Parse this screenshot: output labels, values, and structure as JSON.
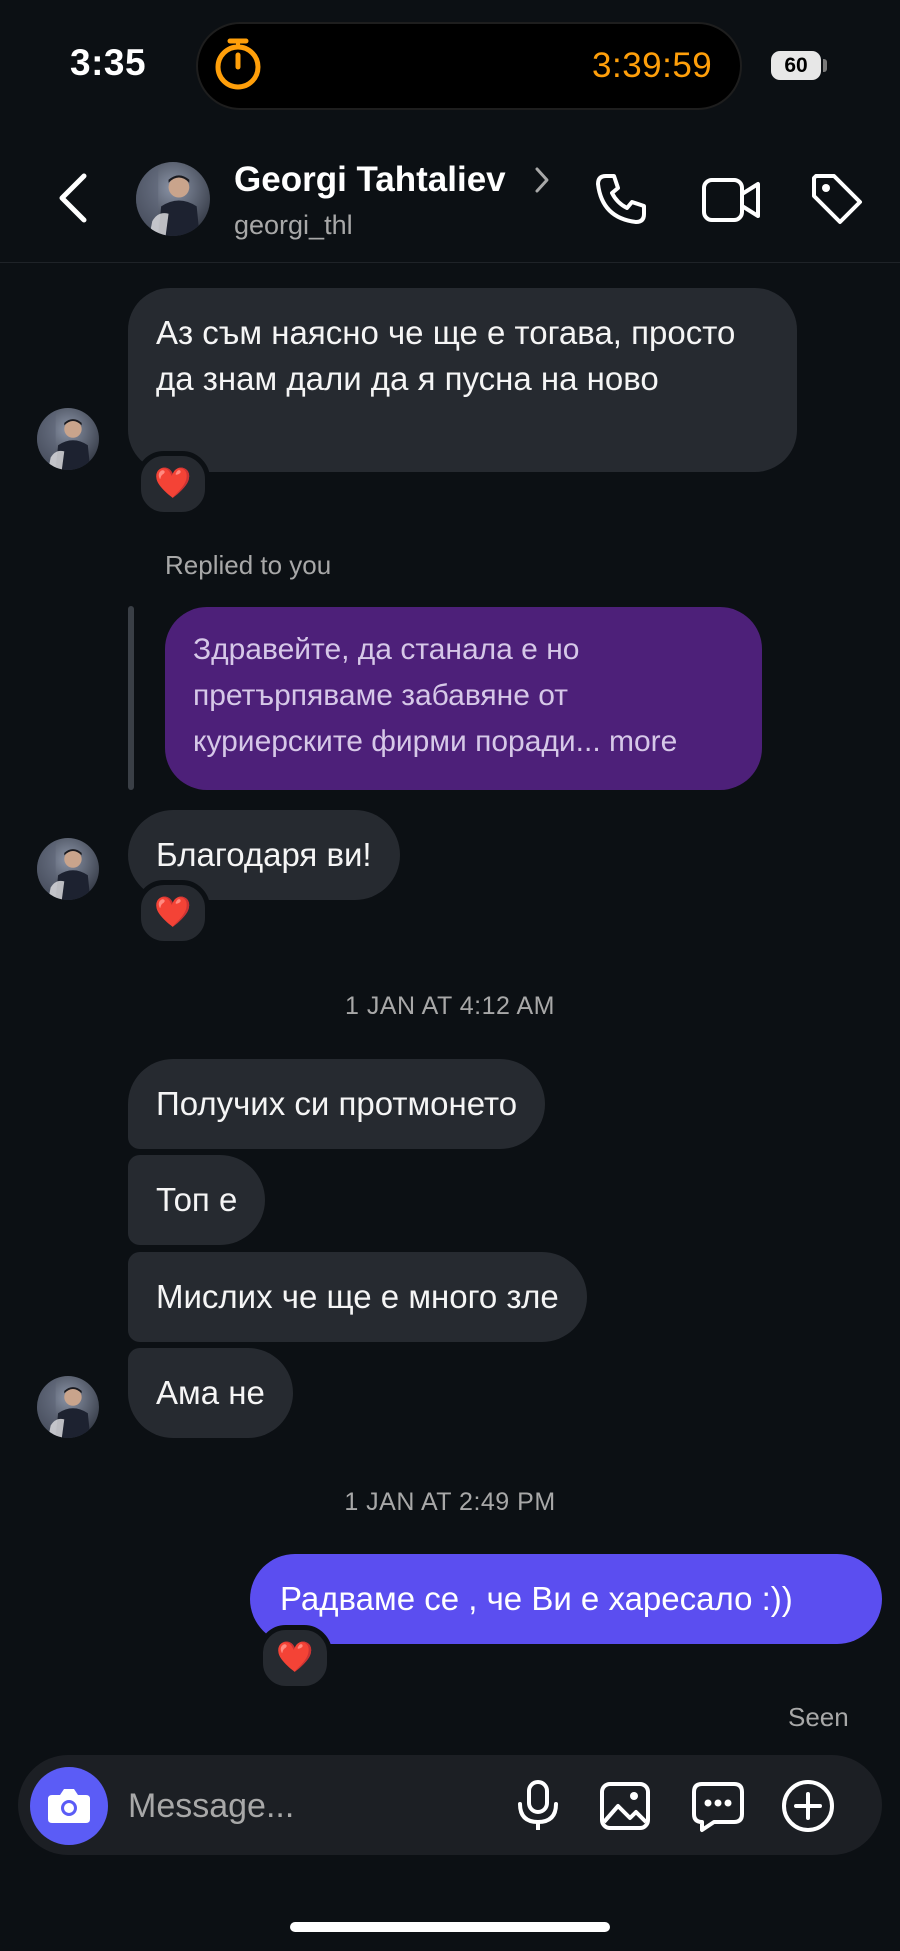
{
  "status_bar": {
    "time": "3:35",
    "timer": "3:39:59",
    "battery": "60"
  },
  "header": {
    "name": "Georgi Tahtaliev",
    "username": "georgi_thl"
  },
  "messages": {
    "m1": "Аз съм наясно че ще е тогава, просто да знам дали да я пусна на ново",
    "m1_reaction": "❤️",
    "replied_label": "Replied to you",
    "reply_quote": "Здравейте, да станала е но претърпяваме забавяне от куриерските фирми поради... more",
    "m2": "Благодаря ви!",
    "m2_reaction": "❤️",
    "date1": "1 JAN AT 4:12 AM",
    "m3": "Получих си протмонето",
    "m4": "Топ е",
    "m5": "Мислих че ще е много зле",
    "m6": "Ама не",
    "date2": "1 JAN AT 2:49 PM",
    "m7": "Радваме се , че Ви е харесало :))",
    "m7_reaction": "❤️",
    "seen": "Seen"
  },
  "composer": {
    "placeholder": "Message..."
  },
  "colors": {
    "background": "#0c1014",
    "incoming_bubble": "#262a30",
    "outgoing_bubble": "#5b4ef0",
    "reply_bubble": "#4d2079",
    "timer": "#ff9f0a",
    "camera_button": "#5b5cf6"
  },
  "icons": {
    "back": "chevron-left-icon",
    "call": "phone-icon",
    "video": "video-camera-icon",
    "tag": "tag-icon",
    "camera": "camera-icon",
    "mic": "microphone-icon",
    "gallery": "image-icon",
    "sticker": "chat-bubble-icon",
    "plus": "plus-circle-icon",
    "timer": "stopwatch-icon"
  }
}
